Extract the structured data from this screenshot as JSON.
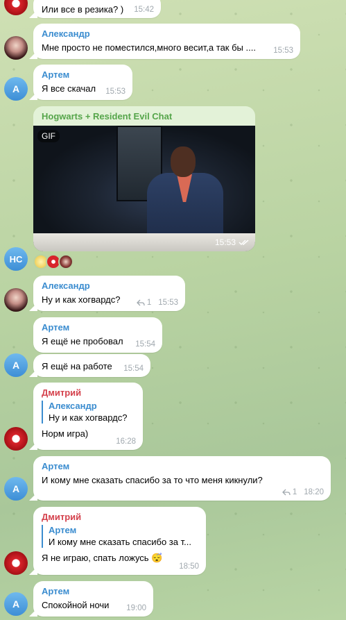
{
  "messages": {
    "m0": {
      "text": "Или все в резика? )",
      "time": "15:42"
    },
    "m1": {
      "sender": "Александр",
      "text": "Мне просто не поместился,много весит,а так бы ....",
      "time": "15:53"
    },
    "m2": {
      "sender": "Артем",
      "text": "Я все скачал",
      "time": "15:53"
    },
    "m3": {
      "sender": "Hogwarts + Resident Evil Chat",
      "gif_label": "GIF",
      "time": "15:53",
      "avatar": "HC"
    },
    "m4": {
      "sender": "Александр",
      "text": "Ну и как хогвардс?",
      "replies": "1",
      "time": "15:53"
    },
    "m5": {
      "sender": "Артем",
      "text": "Я ещё не пробовал",
      "time": "15:54"
    },
    "m6": {
      "text": "Я ещё на работе",
      "time": "15:54",
      "avatar": "A"
    },
    "m7": {
      "sender": "Дмитрий",
      "quote_name": "Александр",
      "quote_text": "Ну и как хогвардс?",
      "text": "Норм игра)",
      "time": "16:28"
    },
    "m8": {
      "sender": "Артем",
      "text": "И кому мне сказать спасибо за то что меня кикнули?",
      "replies": "1",
      "time": "18:20",
      "avatar": "A"
    },
    "m9": {
      "sender": "Дмитрий",
      "quote_name": "Артем",
      "quote_text": "И кому мне сказать спасибо за т...",
      "text": "Я не играю, спать ложусь",
      "emoji": "😴",
      "time": "18:50"
    },
    "m10": {
      "sender": "Артем",
      "text": "Спокойной ночи",
      "time": "19:00",
      "avatar": "A"
    }
  },
  "colors": {
    "blue_name": "#3a8ccf",
    "red_name": "#d4414c",
    "green_name": "#55a54a"
  }
}
